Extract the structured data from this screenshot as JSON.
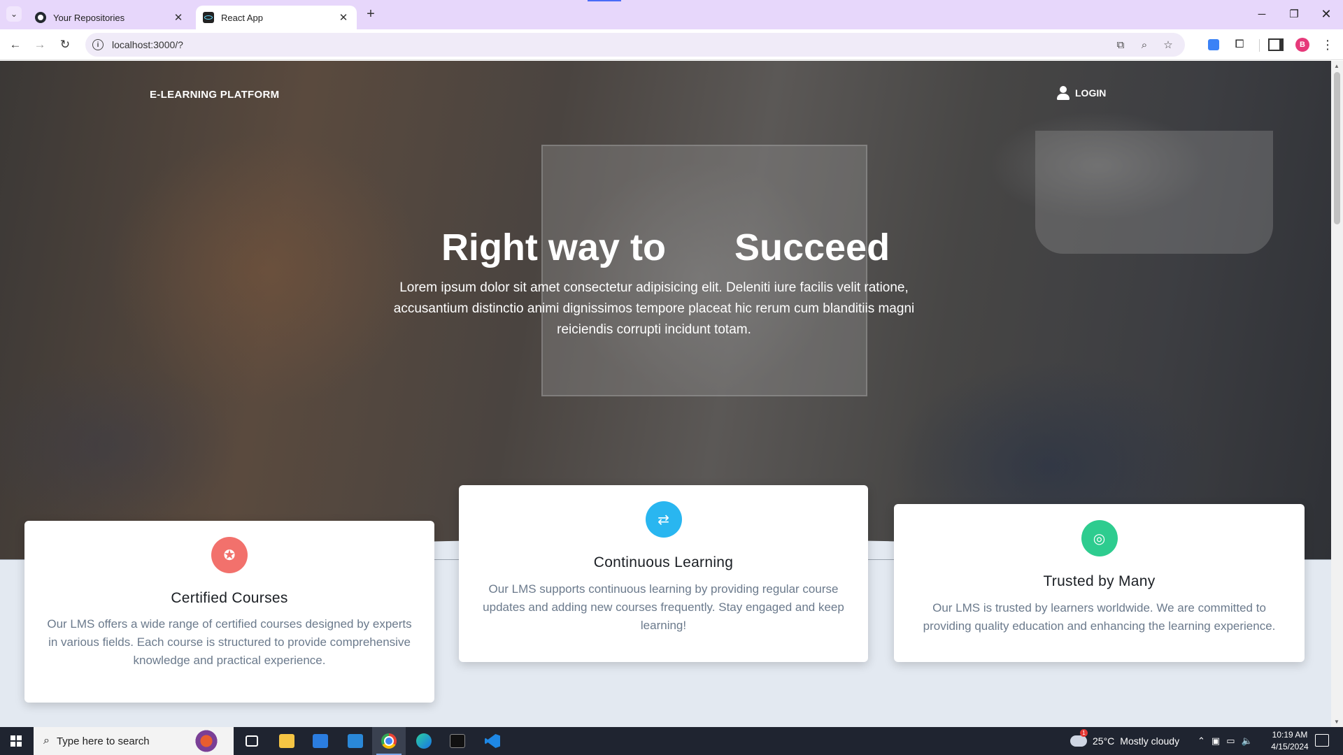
{
  "browser": {
    "tabs": [
      {
        "title": "Your Repositories",
        "icon": "github-icon"
      },
      {
        "title": "React App",
        "icon": "react-icon"
      }
    ],
    "url": "localhost:3000/?",
    "avatar_letter": "B"
  },
  "site": {
    "brand": "E-LEARNING PLATFORM",
    "login_label": "LOGIN"
  },
  "hero": {
    "title_left": "Right way to",
    "title_right": "Succeed",
    "subtitle": "Lorem ipsum dolor sit amet consectetur adipisicing elit. Deleniti iure facilis velit ratione, accusantium distinctio animi dignissimos tempore placeat hic rerum cum blanditiis magni reiciendis corrupti incidunt totam."
  },
  "features": [
    {
      "title": "Certified Courses",
      "text": "Our LMS offers a wide range of certified courses designed by experts in various fields. Each course is structured to provide comprehensive knowledge and practical experience.",
      "icon": "award-icon",
      "color": "#f2716c"
    },
    {
      "title": "Continuous Learning",
      "text": "Our LMS supports continuous learning by providing regular course updates and adding new courses frequently. Stay engaged and keep learning!",
      "icon": "repeat-icon",
      "color": "#29b6f0"
    },
    {
      "title": "Trusted by Many",
      "text": "Our LMS is trusted by learners worldwide. We are committed to providing quality education and enhancing the learning experience.",
      "icon": "fingerprint-icon",
      "color": "#2ecc8f"
    }
  ],
  "taskbar": {
    "search_placeholder": "Type here to search",
    "weather_temp": "25°C",
    "weather_text": "Mostly cloudy",
    "time": "10:19 AM",
    "date": "4/15/2024"
  }
}
